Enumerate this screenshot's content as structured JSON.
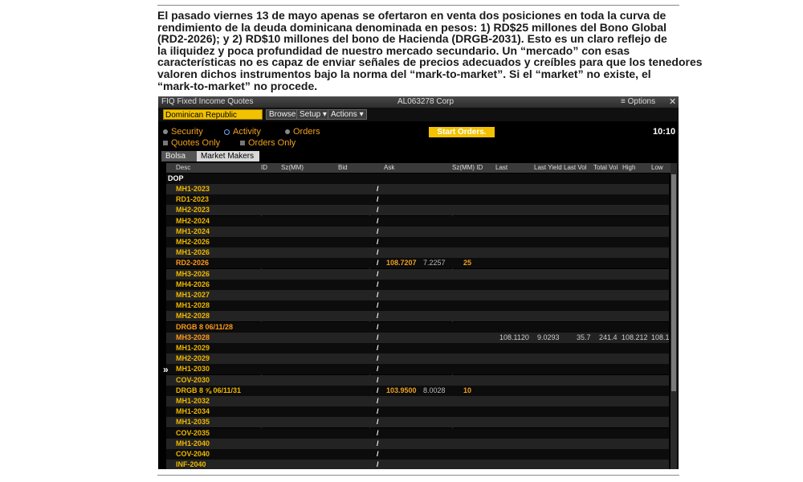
{
  "article": {
    "lines": [
      "El pasado viernes 13 de mayo apenas se ofertaron en venta dos posiciones en toda la curva de",
      " rendimiento de la deuda dominicana denominada en pesos: 1) RD$25 millones del Bono Global",
      "(RD2-2026); y 2) RD$10 millones del bono de Hacienda (DRGB-2031). Esto es un claro reflejo de",
      "la iliquidez y  poca profundidad de nuestro mercado secundario. Un “mercado” con esas",
      "características no es capaz de enviar señales de precios adecuados y creíbles para que los tenedores",
      "valoren dichos instrumentos bajo la norma del “mark-to-market”. Si el “market” no existe, el",
      "“mark-to-market” no procede."
    ]
  },
  "terminal": {
    "title": "FIQ Fixed Income Quotes",
    "security": "AL063278 Corp",
    "options_label": "Options",
    "close_glyph": "✕",
    "gear_glyph": "≡",
    "country": "Dominican Republic",
    "browse": "Browse",
    "setup": "Setup",
    "actions": "Actions",
    "radio_security": "Security",
    "radio_activity": "Activity",
    "radio_orders": "Orders",
    "check_quotes": "Quotes Only",
    "check_orders": "Orders Only",
    "start_orders": "Start Orders.",
    "clock": "10:10",
    "tab_bolsa": "Bolsa",
    "tab_market_makers": "Market Makers",
    "scroll_arrow": "»",
    "columns": {
      "desc": "Desc",
      "id": "ID",
      "sz": "Sz(MM)",
      "bid": "Bid",
      "ask": "Ask",
      "szid": "Sz(MM) ID",
      "last": "Last",
      "last_yield": "Last Yield",
      "last_vol": "Last Vol",
      "total_vol": "Total Vol",
      "high": "High",
      "low": "Low"
    },
    "group": "DOP",
    "rows": [
      {
        "desc": "MH1-2023",
        "slash": "/"
      },
      {
        "desc": "RD1-2023",
        "slash": "/"
      },
      {
        "desc": "MH2-2023",
        "slash": "/"
      },
      {
        "desc": "MH2-2024",
        "slash": "/"
      },
      {
        "desc": "MH1-2024",
        "slash": "/"
      },
      {
        "desc": "MH2-2026",
        "slash": "/"
      },
      {
        "desc": "MH1-2026",
        "slash": "/"
      },
      {
        "desc": "RD2-2026",
        "slash": "/",
        "ask": "108.7207",
        "yield": "7.2257",
        "askid": "25",
        "orange": true
      },
      {
        "desc": "MH3-2026",
        "slash": "/"
      },
      {
        "desc": "MH4-2026",
        "slash": "/"
      },
      {
        "desc": "MH1-2027",
        "slash": "/"
      },
      {
        "desc": "MH1-2028",
        "slash": "/"
      },
      {
        "desc": "MH2-2028",
        "slash": "/"
      },
      {
        "desc": "DRGB 8 06/11/28",
        "slash": "/",
        "orange": true
      },
      {
        "desc": "MH3-2028",
        "slash": "/",
        "last": "108.1120",
        "ly": "9.0293",
        "lv": "35.7",
        "tv": "241.4",
        "hi": "108.212",
        "lo": "108.1",
        "orange": true
      },
      {
        "desc": "MH1-2029",
        "slash": "/"
      },
      {
        "desc": "MH2-2029",
        "slash": "/"
      },
      {
        "desc": "MH1-2030",
        "slash": "/"
      },
      {
        "desc": "COV-2030",
        "slash": "/"
      },
      {
        "desc": "DRGB 8 ⅝ 06/11/31",
        "slash": "/",
        "ask": "103.9500",
        "yield": "8.0028",
        "askid": "10"
      },
      {
        "desc": "MH1-2032",
        "slash": "/"
      },
      {
        "desc": "MH1-2034",
        "slash": "/"
      },
      {
        "desc": "MH1-2035",
        "slash": "/"
      },
      {
        "desc": "COV-2035",
        "slash": "/"
      },
      {
        "desc": "MH1-2040",
        "slash": "/"
      },
      {
        "desc": "COV-2040",
        "slash": "/"
      },
      {
        "desc": "INF-2040",
        "slash": "/"
      }
    ]
  },
  "colors": {
    "accent_yellow": "#f2c200",
    "text_orange": "#f0a020",
    "background": "#000000"
  }
}
